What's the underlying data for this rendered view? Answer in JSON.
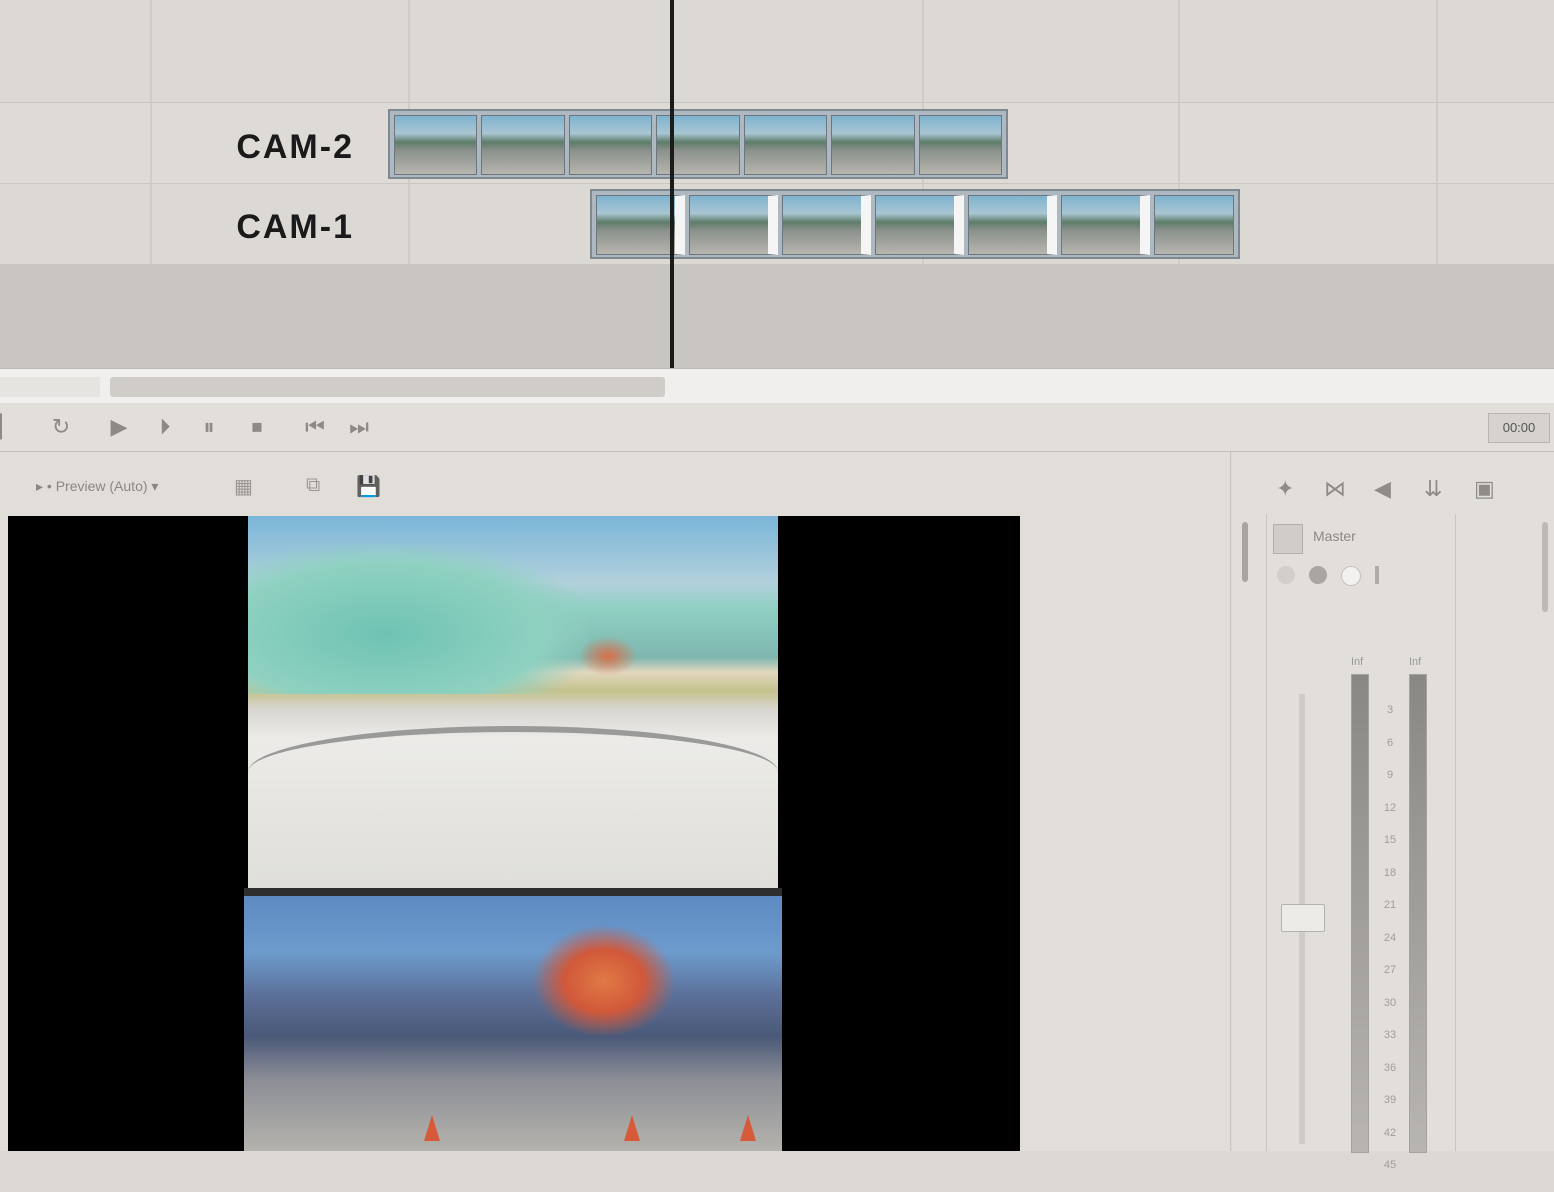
{
  "timeline": {
    "tracks": [
      {
        "label": "CAM-2"
      },
      {
        "label": "CAM-1"
      }
    ]
  },
  "transport": {
    "buttons": [
      "loop-icon",
      "play-icon",
      "play-from-start-icon",
      "pause-icon",
      "stop-icon",
      "prev-frame-icon",
      "next-frame-icon"
    ],
    "timecode": "00:00"
  },
  "preview": {
    "mode_label": "▸ • Preview (Auto) ▾",
    "toolbar_icons": [
      "split-icon",
      "overlay-icon",
      "save-frame-icon"
    ]
  },
  "mixer": {
    "master_label": "Master",
    "meter_labels": [
      "Inf",
      "Inf"
    ],
    "db_scale": [
      "3",
      "6",
      "9",
      "12",
      "15",
      "18",
      "21",
      "24",
      "27",
      "30",
      "33",
      "36",
      "39",
      "42",
      "45"
    ]
  }
}
